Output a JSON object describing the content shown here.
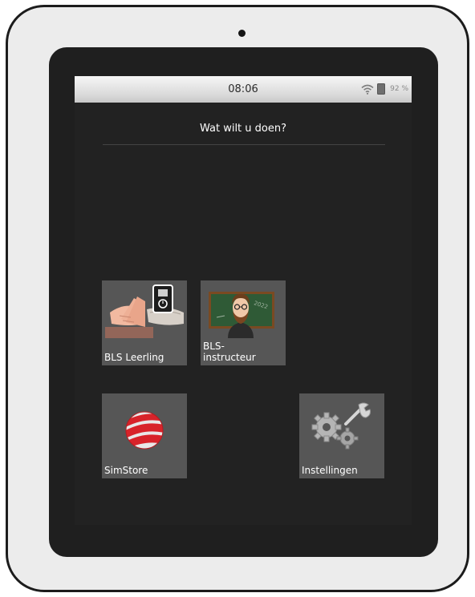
{
  "status_bar": {
    "time": "08:06",
    "battery": "92 %"
  },
  "main": {
    "title": "Wat wilt u doen?"
  },
  "apps": [
    {
      "label": "BLS Leerling",
      "icon": "cpr-hands-icon"
    },
    {
      "label": "BLS-instructeur",
      "icon": "instructor-avatar-icon"
    },
    {
      "label": "SimStore",
      "icon": "simstore-logo-icon"
    },
    {
      "label": "Instellingen",
      "icon": "settings-gears-icon"
    }
  ]
}
